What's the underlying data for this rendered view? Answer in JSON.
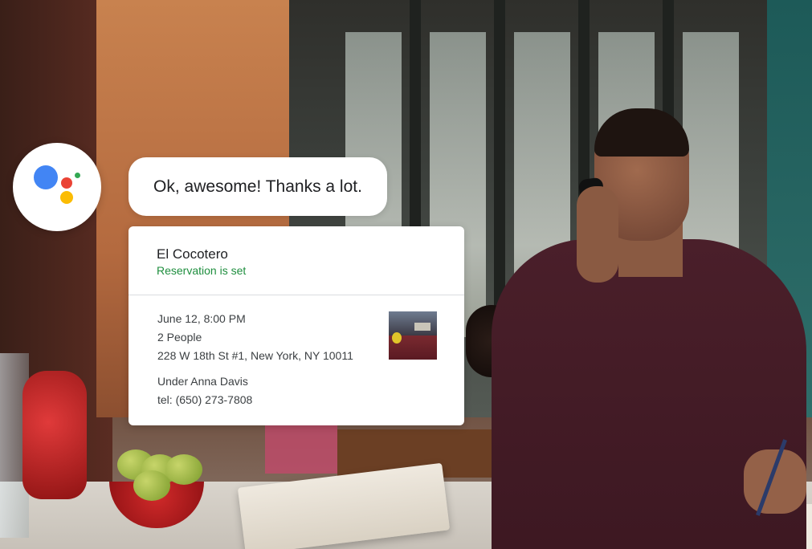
{
  "assistant": {
    "icon": "google-assistant-icon",
    "colors": {
      "blue": "#4285f4",
      "red": "#ea4335",
      "yellow": "#fbbc04",
      "green": "#34a853"
    },
    "message": "Ok, awesome! Thanks a lot."
  },
  "reservation_card": {
    "restaurant_name": "El Cocotero",
    "status": "Reservation is set",
    "status_color": "#1e8e3e",
    "date_time": "June 12, 8:00 PM",
    "party_size": "2 People",
    "address": "228 W 18th St #1, New York, NY 10011",
    "reserved_under": "Under Anna Davis",
    "phone": "tel: (650) 273-7808",
    "thumbnail": "restaurant-photo"
  }
}
